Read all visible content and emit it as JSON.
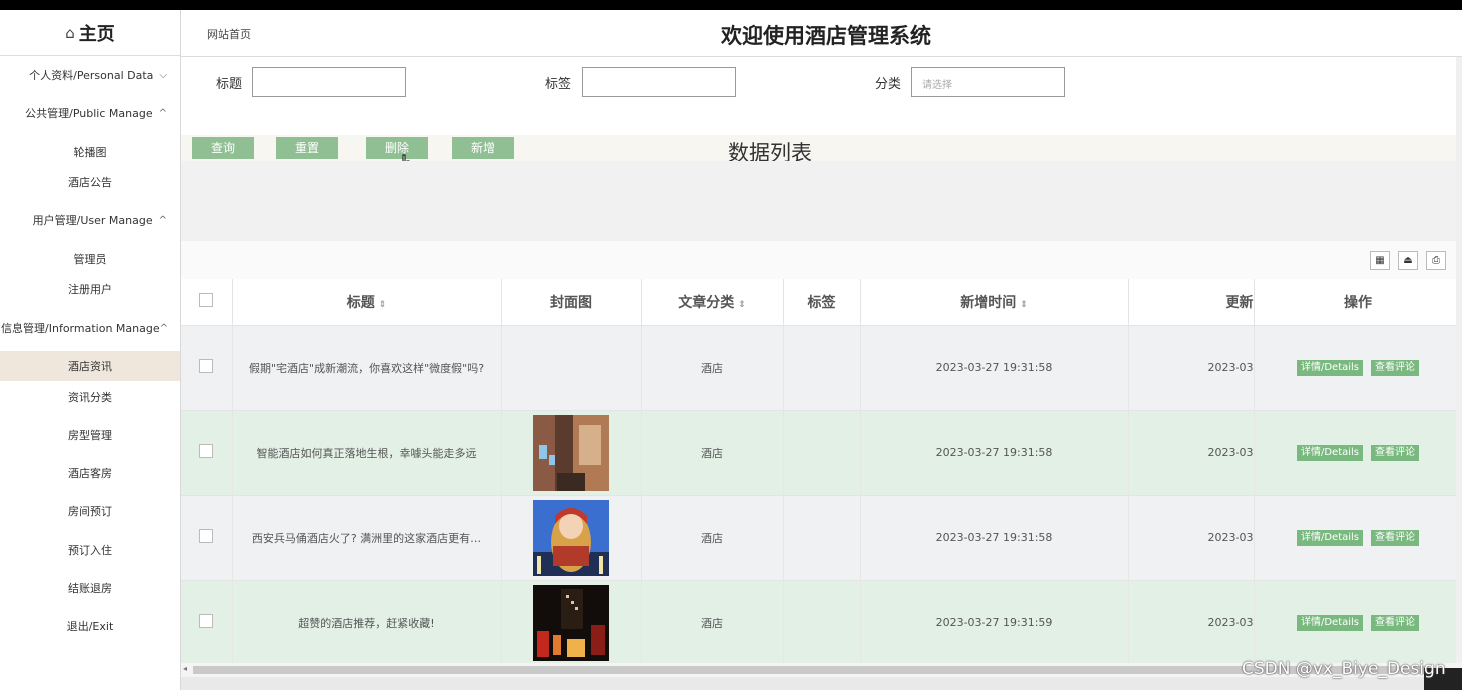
{
  "sidebar": {
    "home_icon": "⌂",
    "home_label": "主页",
    "items": [
      {
        "label": "个人资料/Personal Data",
        "arrow": "⌵",
        "kind": "group"
      },
      {
        "label": "公共管理/Public Manage",
        "arrow": "^",
        "kind": "group"
      },
      {
        "label": "轮播图",
        "kind": "sub"
      },
      {
        "label": "酒店公告",
        "kind": "sub"
      },
      {
        "label": "用户管理/User Manage",
        "arrow": "^",
        "kind": "group"
      },
      {
        "label": "管理员",
        "kind": "sub"
      },
      {
        "label": "注册用户",
        "kind": "sub"
      },
      {
        "label": "信息管理/Information Manage",
        "arrow": "^",
        "kind": "group"
      },
      {
        "label": "酒店资讯",
        "kind": "sub",
        "active": true
      },
      {
        "label": "资讯分类",
        "kind": "sub"
      },
      {
        "label": "房型管理",
        "kind": "sub"
      },
      {
        "label": "酒店客房",
        "kind": "sub"
      },
      {
        "label": "房间预订",
        "kind": "sub"
      },
      {
        "label": "预订入住",
        "kind": "sub"
      },
      {
        "label": "结账退房",
        "kind": "sub"
      },
      {
        "label": "退出/Exit",
        "kind": "sub"
      }
    ]
  },
  "header": {
    "breadcrumb": "网站首页",
    "title": "欢迎使用酒店管理系统"
  },
  "filters": {
    "title_label": "标题",
    "title_value": "",
    "tag_label": "标签",
    "tag_value": "",
    "category_label": "分类",
    "category_placeholder": "请选择"
  },
  "actions": {
    "query": "查询",
    "reset": "重置",
    "delete": "删除",
    "add": "新增"
  },
  "list_title": "数据列表",
  "toolbar_icons": [
    "columns-icon",
    "export-icon",
    "print-icon"
  ],
  "table": {
    "headers": {
      "title": "标题",
      "cover": "封面图",
      "category": "文章分类",
      "tag": "标签",
      "created": "新增时间",
      "updated": "更新",
      "ops": "操作"
    },
    "sort_icon": "⇕",
    "rows": [
      {
        "title": "假期\"宅酒店\"成新潮流，你喜欢这样\"微度假\"吗?",
        "cover": "none",
        "category": "酒店",
        "tag": "",
        "created": "2023-03-27 19:31:58",
        "updated": "2023-03"
      },
      {
        "title": "智能酒店如何真正落地生根，幸噱头能走多远",
        "cover": "hotel-corridor-image",
        "category": "酒店",
        "tag": "",
        "created": "2023-03-27 19:31:58",
        "updated": "2023-03"
      },
      {
        "title": "西安兵马俑酒店火了? 满洲里的这家酒店更有…",
        "cover": "matryoshka-hotel-image",
        "category": "酒店",
        "tag": "",
        "created": "2023-03-27 19:31:58",
        "updated": "2023-03"
      },
      {
        "title": "超赞的酒店推荐，赶紧收藏!",
        "cover": "night-hotel-image",
        "category": "酒店",
        "tag": "",
        "created": "2023-03-27 19:31:59",
        "updated": "2023-03"
      }
    ],
    "details_label": "详情/Details",
    "comments_label": "查看评论"
  },
  "watermark": "CSDN @vx_Biye_Design"
}
